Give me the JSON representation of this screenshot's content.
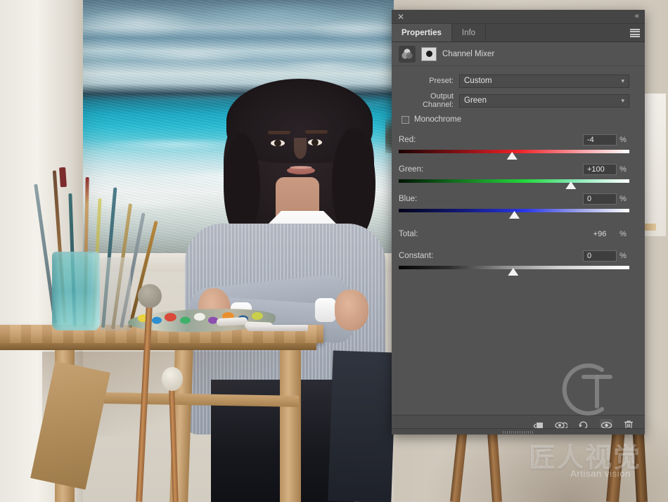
{
  "window": {
    "close_label": "✕",
    "collapse_label": "«"
  },
  "tabs": [
    {
      "label": "Properties",
      "active": true
    },
    {
      "label": "Info",
      "active": false
    }
  ],
  "menu_icon": "hamburger-menu-icon",
  "adjustment": {
    "icon": "channel-mixer-icon",
    "mask_icon": "layer-mask-thumbnail",
    "title": "Channel Mixer"
  },
  "fields": {
    "preset_label": "Preset:",
    "preset_value": "Custom",
    "output_channel_label": "Output Channel:",
    "output_channel_value": "Green",
    "monochrome_label": "Monochrome",
    "monochrome_checked": false
  },
  "sliders": [
    {
      "label": "Red:",
      "value": "-4",
      "unit": "%",
      "percent": 49,
      "track": "red"
    },
    {
      "label": "Green:",
      "value": "+100",
      "unit": "%",
      "percent": 74.5,
      "track": "green"
    },
    {
      "label": "Blue:",
      "value": "0",
      "unit": "%",
      "percent": 50,
      "track": "blue"
    }
  ],
  "total": {
    "label": "Total:",
    "value": "+96",
    "unit": "%"
  },
  "constant": {
    "label": "Constant:",
    "value": "0",
    "unit": "%",
    "percent": 49.5,
    "track": "gray"
  },
  "footer_icons": [
    {
      "name": "clip-to-layer-icon",
      "selected": false
    },
    {
      "name": "toggle-preview-icon",
      "selected": false
    },
    {
      "name": "reset-adjustment-icon",
      "selected": false
    },
    {
      "name": "layer-visibility-icon",
      "selected": true
    },
    {
      "name": "delete-layer-icon",
      "selected": false
    }
  ],
  "watermark": {
    "chinese": "匠人视觉",
    "english": "Artisan vision",
    "monogram": "CT-monogram"
  },
  "colors": {
    "panel_bg": "#535353",
    "panel_header": "#454545",
    "red_accent": "#f02027",
    "green_accent": "#23d93c",
    "blue_accent": "#2a37e8"
  }
}
